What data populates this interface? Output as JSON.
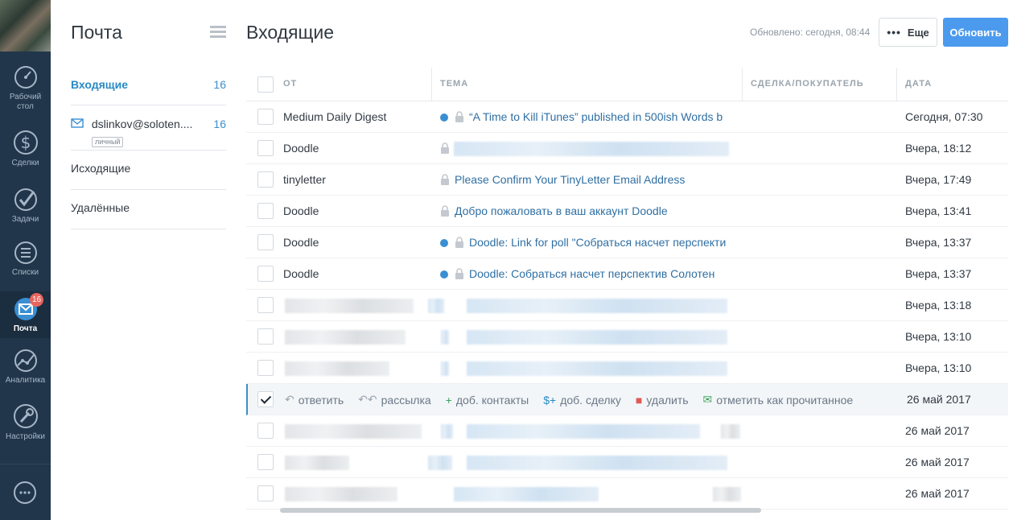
{
  "rail": {
    "items": [
      {
        "label": "Рабочий\nстол",
        "icon": "speedometer-icon"
      },
      {
        "label": "Сделки",
        "icon": "dollar-icon"
      },
      {
        "label": "Задачи",
        "icon": "checkmark-icon"
      },
      {
        "label": "Списки",
        "icon": "list-icon"
      },
      {
        "label": "Почта",
        "icon": "mail-icon",
        "badge": "16",
        "active": true
      },
      {
        "label": "Аналитика",
        "icon": "chart-icon"
      },
      {
        "label": "Настройки",
        "icon": "wrench-icon"
      }
    ],
    "chat_icon": "chat-icon"
  },
  "folders": {
    "title": "Почта",
    "items": [
      {
        "name": "Входящие",
        "count": "16"
      },
      {
        "name": "dslinkov@soloten....",
        "count": "16",
        "tag": "личный"
      },
      {
        "name": "Исходящие"
      },
      {
        "name": "Удалённые"
      }
    ]
  },
  "main": {
    "title": "Входящие",
    "updated": "Обновлено: сегодня, 08:44",
    "more_label": "Еще",
    "refresh_label": "Обновить"
  },
  "table": {
    "columns": [
      "ОТ",
      "ТЕМА",
      "СДЕЛКА/ПОКУПАТЕЛЬ",
      "ДАТА"
    ],
    "rows": [
      {
        "from": "Medium Daily Digest",
        "subject": "“A Time to Kill iTunes” published in 500ish Words b",
        "date": "Сегодня, 07:30",
        "unread": true,
        "locked": true
      },
      {
        "from": "Doodle",
        "subject": "",
        "date": "Вчера, 18:12",
        "locked": true
      },
      {
        "from": "tinyletter",
        "subject": "Please Confirm Your TinyLetter Email Address",
        "date": "Вчера, 17:49",
        "locked": true
      },
      {
        "from": "Doodle",
        "subject": "Добро пожаловать в ваш аккаунт Doodle",
        "date": "Вчера, 13:41",
        "locked": true
      },
      {
        "from": "Doodle",
        "subject": "Doodle: Link for poll \"Собраться насчет перспекти",
        "date": "Вчера, 13:37",
        "unread": true,
        "locked": true
      },
      {
        "from": "Doodle",
        "subject": "Doodle: Собраться насчет перспектив Солотен",
        "date": "Вчера, 13:37",
        "unread": true,
        "locked": true
      },
      {
        "from": "",
        "subject": "",
        "date": "Вчера, 13:18"
      },
      {
        "from": "",
        "subject": "",
        "date": "Вчера, 13:10"
      },
      {
        "from": "",
        "subject": "",
        "date": "Вчера, 13:10"
      },
      {
        "from": "",
        "subject": "",
        "date": "26 май 2017",
        "selected": true
      },
      {
        "from": "",
        "subject": "",
        "date": "26 май 2017"
      },
      {
        "from": "",
        "subject": "",
        "date": "26 май 2017"
      },
      {
        "from": "",
        "subject": "",
        "date": "26 май 2017"
      }
    ],
    "row_actions": [
      {
        "label": "ответить",
        "icon": "reply-icon",
        "color": "#9aa4ad"
      },
      {
        "label": "рассылка",
        "icon": "reply-all-icon",
        "color": "#9aa4ad"
      },
      {
        "label": "доб. контакты",
        "icon": "add-contact-icon",
        "color": "#3fa45b"
      },
      {
        "label": "доб. сделку",
        "icon": "add-deal-icon",
        "color": "#2a8ac5"
      },
      {
        "label": "удалить",
        "icon": "trash-icon",
        "color": "#e05a55"
      },
      {
        "label": "отметить как прочитанное",
        "icon": "open-envelope-icon",
        "color": "#3fa45b"
      }
    ]
  }
}
